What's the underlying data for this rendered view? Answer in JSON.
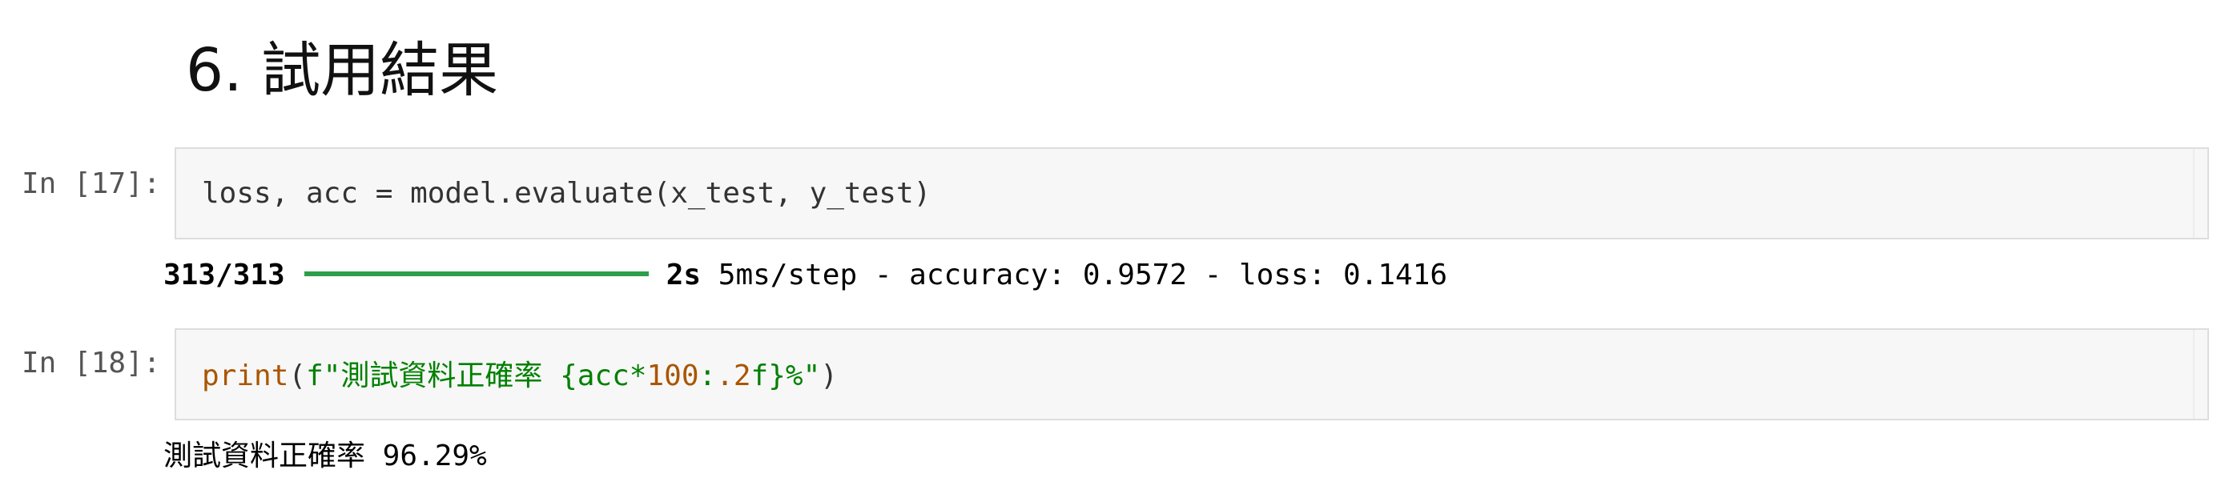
{
  "heading": "6. 試用結果",
  "cells": [
    {
      "prompt": "In [17]:",
      "code": "loss, acc = model.evaluate(x_test, y_test)",
      "output": {
        "progress_count": "313/313",
        "progress_fraction": 1.0,
        "progress_time": "2s",
        "progress_rest": "5ms/step - accuracy: 0.9572 - loss: 0.1416"
      }
    },
    {
      "prompt": "In [18]:",
      "code_tokens": {
        "func": "print",
        "open": "(",
        "str_start": "f\"測試資料正確率 {acc*",
        "num1": "100",
        "colon": ":",
        "num2": ".2",
        "str_end": "f}%\"",
        "close": ")"
      },
      "output_text": "測試資料正確率 96.29%"
    }
  ],
  "colors": {
    "progress_bar": "#2e9e4a",
    "keyword_func": "#aa5500",
    "string": "#008000"
  }
}
